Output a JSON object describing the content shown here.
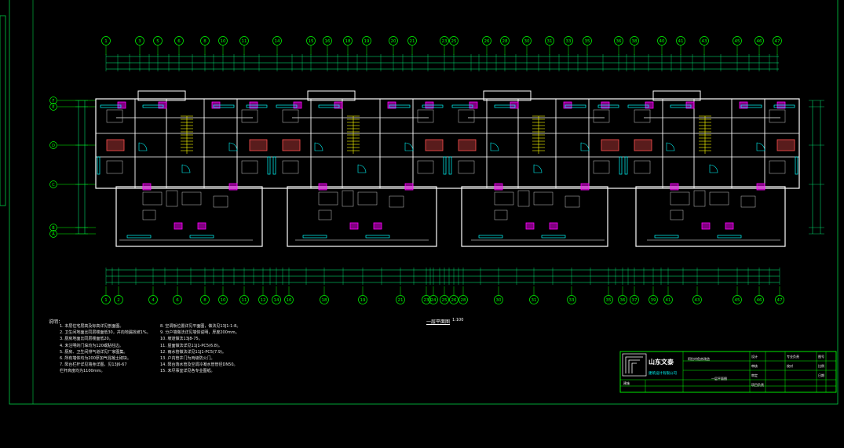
{
  "drawing": {
    "plan_title": "一层平面图",
    "plan_scale": "1:100"
  },
  "grid_axes": {
    "top": [
      "1",
      "3",
      "5",
      "6",
      "8",
      "10",
      "11",
      "14",
      "15",
      "16",
      "18",
      "19",
      "20",
      "21",
      "23",
      "25",
      "26",
      "28",
      "30",
      "31",
      "33",
      "35",
      "36",
      "38",
      "40",
      "41",
      "43",
      "45",
      "46",
      "47"
    ],
    "bottom": [
      "1",
      "2",
      "4",
      "6",
      "8",
      "10",
      "11",
      "12",
      "14",
      "16",
      "18",
      "19",
      "21",
      "23",
      "24",
      "25",
      "26",
      "28",
      "30",
      "31",
      "33",
      "35",
      "36",
      "37",
      "39",
      "41",
      "43",
      "45",
      "46",
      "47"
    ],
    "left": [
      "F",
      "E",
      "D",
      "C",
      "B",
      "A"
    ]
  },
  "notes": {
    "title": "说明：",
    "left_col": [
      "1. 本层住宅层高及标高详见剖面图。",
      "2. 卫生间地面比同层楼面低30，并向地漏找坡1%。",
      "3. 厨房地面比同层楼面低20。",
      "4. 未注明的门垛均为120或贴柱边。",
      "5. 厨房、卫生间排气道详见厂家图集。",
      "6. 所有墙体均为200厚加气混凝土砌块。",
      "7. 阳台栏杆详见墙身详图，见13J6-67",
      "   栏杆高度均为1100mm。"
    ],
    "right_col": [
      "8. 空调板位置详见平面图，做法见13J1-1-8。",
      "9. 分户墙做法详见墙体说明，厚度200mm。",
      "10. 坡道做法13J8-75。",
      "11. 屋面做法详见11J1-PC5(6.8)。",
      "12. 雨水管做法详见11J1-PC5(7.9)。",
      "13. 户内管井门为丙级防火门。",
      "14. 阳台落水管及空调冷凝水管管径DN50。",
      "15. 未尽事宜详见各专业图纸。"
    ]
  },
  "title_block": {
    "company": "山东文泰",
    "company_sub": "建筑设计有限公司",
    "project_label": "阿拉村危房改造",
    "sheet_label": "一层平面图",
    "drawing_no_label": "建施",
    "row_labels": [
      "设计",
      "审核",
      "审定",
      "项目负责",
      "专业负责",
      "校对"
    ],
    "code_labels": [
      "图号",
      "比例",
      "日期"
    ]
  },
  "colors": {
    "walls": "#ffffff",
    "dimension": "#00ff7f",
    "axis": "#00ff00",
    "windows": "#00ffff",
    "doors": "#00ffff",
    "magenta": "#ff00ff",
    "stairs": "#ffff00",
    "furniture": "#c8c8c8",
    "red": "#ff5050",
    "frame": "#00ff00"
  }
}
